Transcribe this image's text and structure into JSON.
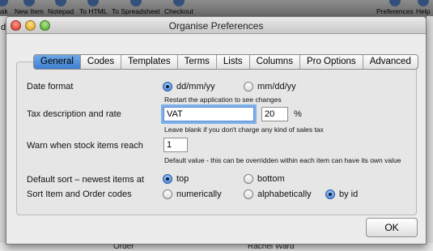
{
  "app_toolbar": {
    "items": [
      {
        "label": "ask"
      },
      {
        "label": "New Item"
      },
      {
        "label": "Notepad"
      },
      {
        "label": "To HTML"
      },
      {
        "label": "To Spreadsheet"
      },
      {
        "label": "Checkout"
      },
      {
        "label": "Preferences"
      },
      {
        "label": "Help"
      }
    ]
  },
  "background": {
    "left_fragment": "d",
    "bottom_left_text": "Order",
    "bottom_right_text": "Rachel Ward"
  },
  "window": {
    "title": "Organise Preferences"
  },
  "tabs": [
    {
      "label": "General",
      "active": true
    },
    {
      "label": "Codes"
    },
    {
      "label": "Templates"
    },
    {
      "label": "Terms"
    },
    {
      "label": "Lists"
    },
    {
      "label": "Columns"
    },
    {
      "label": "Pro Options"
    },
    {
      "label": "Advanced"
    }
  ],
  "date_format": {
    "label": "Date format",
    "options": [
      {
        "label": "dd/mm/yy",
        "selected": true
      },
      {
        "label": "mm/dd/yy",
        "selected": false
      }
    ],
    "hint": "Restart the application to see changes"
  },
  "tax": {
    "label": "Tax description and rate",
    "description_value": "VAT",
    "rate_value": "20",
    "unit": "%",
    "hint": "Leave blank if you don't charge any kind of sales tax"
  },
  "stock_warning": {
    "label": "Warn when stock items reach",
    "value": "1",
    "hint": "Default value - this can be overridden within each item can have its own value"
  },
  "default_sort": {
    "label": "Default sort – newest items at",
    "options": [
      {
        "label": "top",
        "selected": true
      },
      {
        "label": "bottom",
        "selected": false
      }
    ]
  },
  "sort_codes": {
    "label": "Sort Item and Order codes",
    "options": [
      {
        "label": "numerically",
        "selected": false
      },
      {
        "label": "alphabetically",
        "selected": false
      },
      {
        "label": "by id",
        "selected": true
      }
    ]
  },
  "buttons": {
    "ok": "OK"
  },
  "colors": {
    "active_tab": "#4a8ad8",
    "focus_ring": "#7fb0ec"
  }
}
